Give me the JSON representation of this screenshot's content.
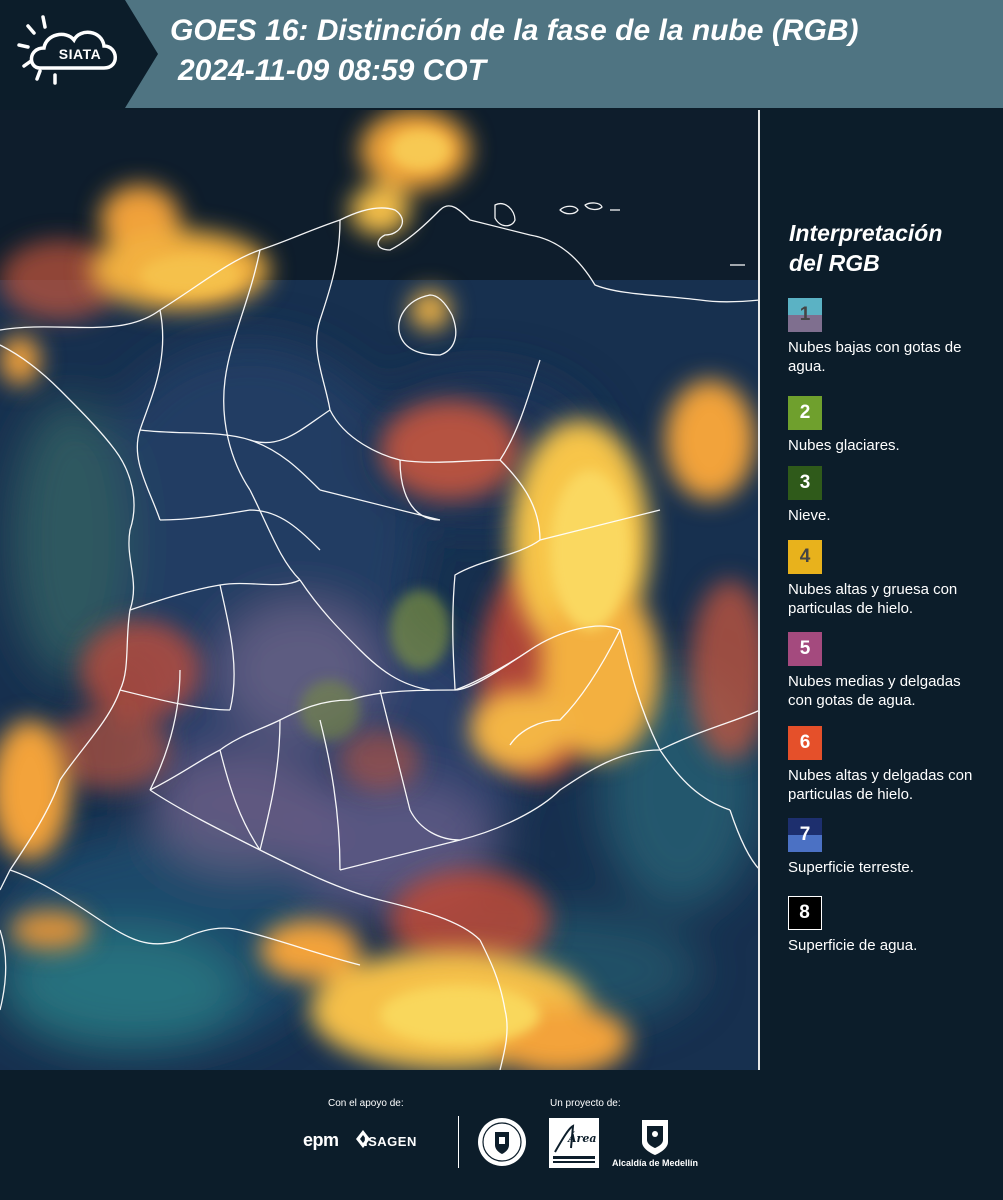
{
  "header": {
    "logo_text": "SIATA",
    "title_line1": "GOES 16: Distinción de la fase de la nube (RGB)",
    "title_line2": "2024-11-09 08:59 COT"
  },
  "legend": {
    "title_line1": "Interpretación",
    "title_line2": "del RGB",
    "items": [
      {
        "num": "1",
        "text": "Nubes bajas con gotas de agua.",
        "color_top": "#5bb2c4",
        "color_bottom": "#7f6f8f",
        "num_color": "#444444"
      },
      {
        "num": "2",
        "text": "Nubes glaciares.",
        "color_top": "#6fa02d",
        "color_bottom": "#6fa02d",
        "num_color": "#ffffff"
      },
      {
        "num": "3",
        "text": "Nieve.",
        "color_top": "#2f5a1a",
        "color_bottom": "#2f5a1a",
        "num_color": "#ffffff"
      },
      {
        "num": "4",
        "text": "Nubes altas y gruesa con particulas de hielo.",
        "color_top": "#e8b21c",
        "color_bottom": "#e8b21c",
        "num_color": "#444444"
      },
      {
        "num": "5",
        "text": "Nubes medias y delgadas con gotas de agua.",
        "color_top": "#a44a7e",
        "color_bottom": "#a44a7e",
        "num_color": "#ffffff"
      },
      {
        "num": "6",
        "text": "Nubes altas y delgadas con particulas de hielo.",
        "color_top": "#e5502a",
        "color_bottom": "#e5502a",
        "num_color": "#ffffff"
      },
      {
        "num": "7",
        "text": "Superficie terreste.",
        "color_top": "#1d2f6e",
        "color_bottom": "#4b71c4",
        "num_color": "#ffffff"
      },
      {
        "num": "8",
        "text": "Superficie de agua.",
        "color_top": "#000000",
        "color_bottom": "#000000",
        "num_color": "#ffffff"
      }
    ]
  },
  "footer": {
    "support_label": "Con el apoyo de:",
    "project_label": "Un proyecto de:",
    "epm": "epm",
    "isagen": "ISAGEN",
    "area_text": "Área",
    "alcaldia": "Alcaldía de Medellín"
  },
  "colors": {
    "header_bg": "#4f7482",
    "page_bg": "#0c1d2a",
    "cloud_orange": "#f3a33a",
    "cloud_yellow": "#f7d04a",
    "cloud_red": "#d8563a",
    "cloud_pink": "#9a6f95",
    "land_blue": "#1e3a5e"
  }
}
